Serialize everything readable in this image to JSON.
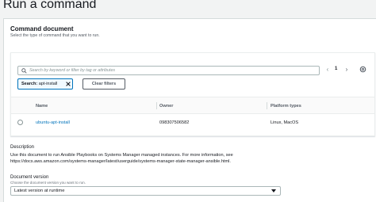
{
  "page": {
    "title": "Run a command"
  },
  "command_document": {
    "title": "Command document",
    "subtitle": "Select the type of command that you want to run.",
    "search": {
      "placeholder": "Search by keyword or filter by tag or attributes",
      "value": ""
    },
    "pagination": {
      "current_page": "1"
    },
    "filter_token": {
      "key": "Search:",
      "value": "apt-install"
    },
    "clear_filters_label": "Clear filters",
    "table": {
      "columns": [
        "Name",
        "Owner",
        "Platform types"
      ],
      "rows": [
        {
          "name": "ubuntu-apt-install",
          "owner": "098307506582",
          "platforms": "Linux, MacOS",
          "selected": false
        }
      ]
    }
  },
  "description": {
    "label": "Description",
    "text": "Use this document to run Ansible Playbooks on Systems Manager managed instances. For more information, see https://docs.aws.amazon.com/systems-manager/latest/userguide/systems-manager-state-manager-ansible.html."
  },
  "document_version": {
    "label": "Document version",
    "hint": "Choose the document version you want to run.",
    "selected": "Latest version at runtime"
  },
  "icons": {
    "search": "search-icon",
    "prev": "chevron-left-icon",
    "next": "chevron-right-icon",
    "settings": "gear-icon",
    "remove": "close-icon",
    "dropdown": "caret-down-icon"
  },
  "colors": {
    "link": "#0073bb",
    "token_border": "#0073bb",
    "background": "#f2f3f3"
  }
}
